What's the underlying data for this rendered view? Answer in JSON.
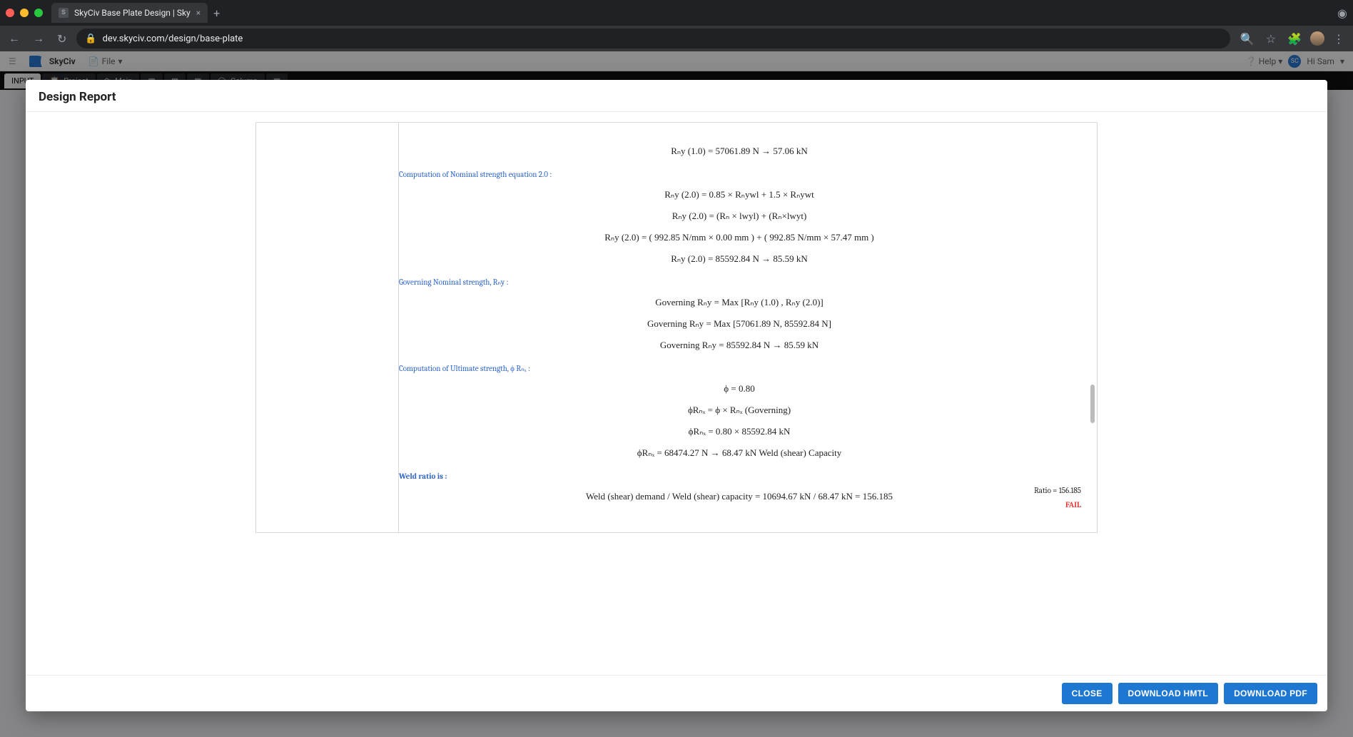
{
  "browser": {
    "tab_title": "SkyCiv Base Plate Design | Sky",
    "favicon_letter": "S",
    "url_display": "dev.skyciv.com/design/base-plate",
    "new_tab_glyph": "+",
    "close_glyph": "×",
    "nav": {
      "back": "←",
      "forward": "→",
      "reload": "↻",
      "lock": "🔒",
      "search": "🔍",
      "star": "☆",
      "ext": "🧩",
      "menu": "⋮"
    }
  },
  "app": {
    "brand_name": "SkyCiv",
    "file_label": "File",
    "file_chevron": "▾",
    "help_label": "Help",
    "help_chevron": "▾",
    "user_badge": "SC",
    "user_greeting": "Hi Sam",
    "user_chevron": "▾",
    "tabs": {
      "input": "INPUT",
      "project": "Project",
      "main": "Main",
      "column": "Column"
    }
  },
  "modal": {
    "title": "Design Report",
    "footer": {
      "close": "CLOSE",
      "download_html": "DOWNLOAD HMTL",
      "download_pdf": "DOWNLOAD PDF"
    }
  },
  "report": {
    "sections": {
      "s0_eq1": "Rₙy (1.0) = 57061.89 N → 57.06 kN",
      "s1_label": "Computation of Nominal strength equation 2.0 :",
      "s1_eq1": "Rₙy (2.0) = 0.85 × Rₙywl + 1.5 × Rₙywt",
      "s1_eq2": "Rₙy (2.0) = (Rₙ × lwyl) + (Rₙ×lwyt)",
      "s1_eq3": "Rₙy (2.0) = ( 992.85 N/mm × 0.00 mm ) + ( 992.85 N/mm × 57.47 mm )",
      "s1_eq4": "Rₙy (2.0) = 85592.84 N → 85.59 kN",
      "s2_label": "Governing Nominal strength, Rₙy :",
      "s2_eq1": "Governing Rₙy = Max [Rₙy (1.0) , Rₙy (2.0)]",
      "s2_eq2": "Governing Rₙy = Max [57061.89 N, 85592.84 N]",
      "s2_eq3": "Governing Rₙy = 85592.84 N → 85.59 kN",
      "s3_label": "Computation of Ultimate strength, ϕ Rₙₓ :",
      "s3_eq1": "ϕ = 0.80",
      "s3_eq2": "ϕRₙₓ = ϕ × Rₙₓ (Governing)",
      "s3_eq3": "ϕRₙₓ = 0.80 × 85592.84 kN",
      "s3_eq4": "ϕRₙₓ = 68474.27 N → 68.47 kN Weld (shear) Capacity",
      "s4_label": "Weld ratio is :",
      "s4_eq1": "Weld (shear) demand / Weld (shear) capacity = 10694.67 kN / 68.47 kN = 156.185"
    },
    "ratio_label": "Ratio = ",
    "ratio_value": "156.185",
    "result": "FAIL"
  }
}
